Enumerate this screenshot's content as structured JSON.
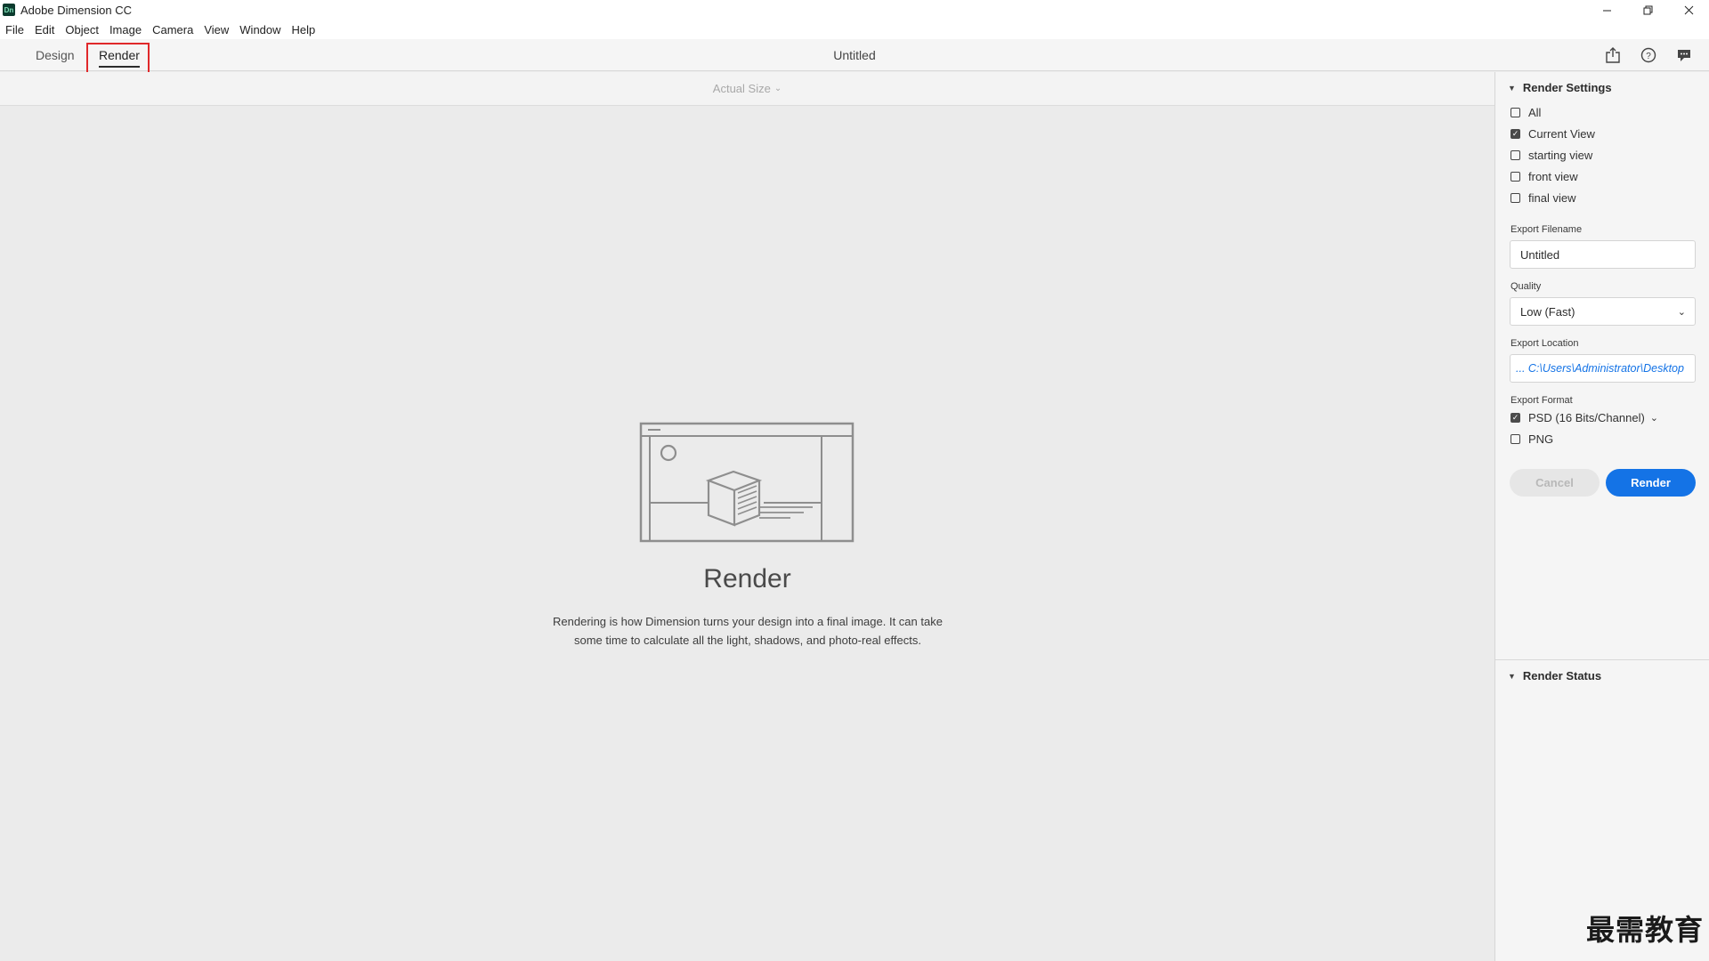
{
  "window": {
    "app_title": "Adobe Dimension CC",
    "logo_text": "Dn"
  },
  "menu": [
    "File",
    "Edit",
    "Object",
    "Image",
    "Camera",
    "View",
    "Window",
    "Help"
  ],
  "tabs": {
    "design": "Design",
    "render": "Render",
    "active": "render"
  },
  "document": {
    "title": "Untitled"
  },
  "canvas": {
    "zoom_label": "Actual Size",
    "heading": "Render",
    "description": "Rendering is how Dimension turns your design into a final image. It can take some time to calculate all the light, shadows, and photo-real effects."
  },
  "render_settings": {
    "title": "Render Settings",
    "views": [
      {
        "label": "All",
        "checked": false
      },
      {
        "label": "Current View",
        "checked": true
      },
      {
        "label": "starting view",
        "checked": false
      },
      {
        "label": "front view",
        "checked": false
      },
      {
        "label": "final view",
        "checked": false
      }
    ],
    "export_filename_label": "Export Filename",
    "export_filename_value": "Untitled",
    "quality_label": "Quality",
    "quality_value": "Low (Fast)",
    "export_location_label": "Export Location",
    "export_location_value": "... C:\\Users\\Administrator\\Desktop",
    "export_format_label": "Export Format",
    "formats": [
      {
        "label": "PSD (16 Bits/Channel)",
        "checked": true
      },
      {
        "label": "PNG",
        "checked": false
      }
    ],
    "cancel_label": "Cancel",
    "render_label": "Render"
  },
  "render_status": {
    "title": "Render Status"
  },
  "watermark": "最需教育",
  "colors": {
    "accent": "#1473e6",
    "highlight": "#e0282a"
  }
}
